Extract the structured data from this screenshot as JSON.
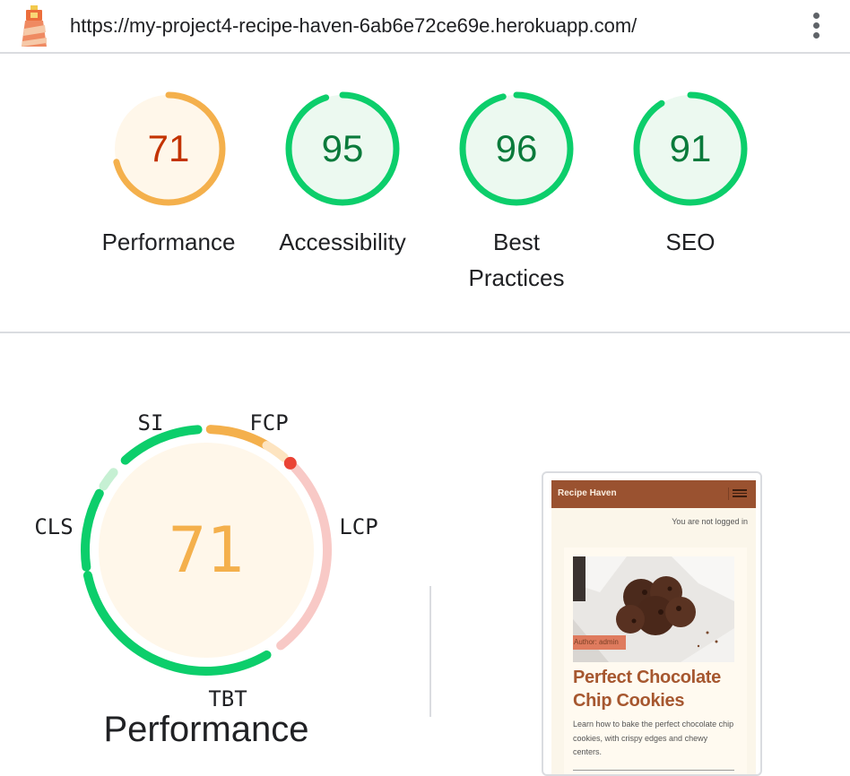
{
  "browser": {
    "url": "https://my-project4-recipe-haven-6ab6e72ce69e.herokuapp.com/",
    "logo_icon": "lighthouse-icon",
    "menu_icon": "kebab-menu-icon"
  },
  "scores": [
    {
      "label": "Performance",
      "score": "71",
      "value": 0.71,
      "status": "average"
    },
    {
      "label": "Accessibility",
      "score": "95",
      "value": 0.95,
      "status": "pass"
    },
    {
      "label": "Best Practices",
      "score": "96",
      "value": 0.96,
      "status": "pass"
    },
    {
      "label": "SEO",
      "score": "91",
      "value": 0.91,
      "status": "pass"
    }
  ],
  "colors": {
    "pass": "#0cce6b",
    "pass_text": "#0a7a3b",
    "pass_bg": "#ecf9f0",
    "average": "#f4b04c",
    "average_text": "#c33300",
    "average_bg": "#fff7ea",
    "fail": "#ea4335",
    "fail_light": "#f8c9c6"
  },
  "performance_detail": {
    "score": "71",
    "title": "Performance",
    "metrics": [
      {
        "abbr": "FCP",
        "status": "average"
      },
      {
        "abbr": "LCP",
        "status": "fail"
      },
      {
        "abbr": "TBT",
        "status": "pass"
      },
      {
        "abbr": "CLS",
        "status": "pass"
      },
      {
        "abbr": "SI",
        "status": "pass"
      }
    ]
  },
  "preview": {
    "brand": "Recipe Haven",
    "login_status": "You are not logged in",
    "author_badge": "Author: admin",
    "recipe_title": "Perfect Chocolate Chip Cookies",
    "recipe_desc": "Learn how to bake the perfect chocolate chip cookies, with crispy edges and chewy centers."
  }
}
